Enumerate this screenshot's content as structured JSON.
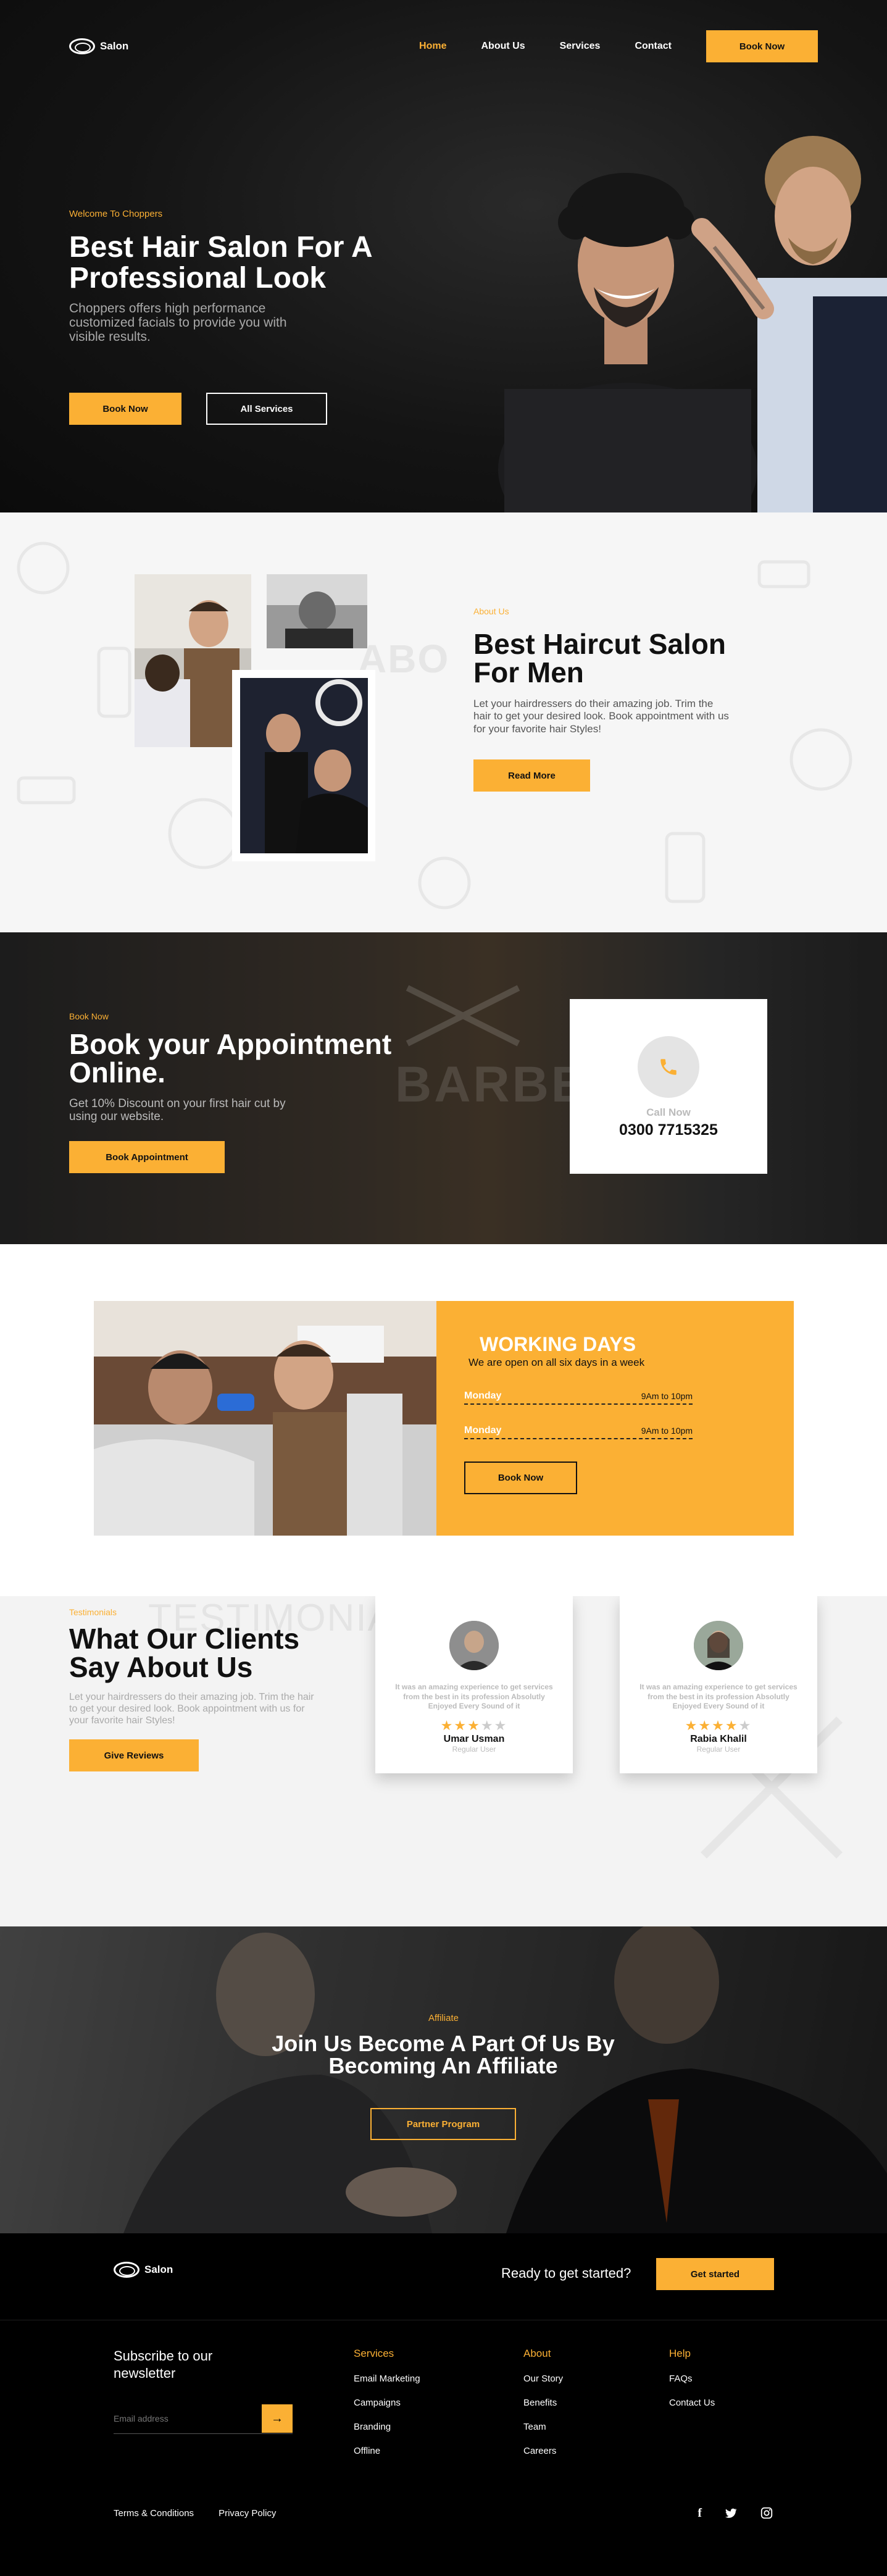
{
  "brand": {
    "name": "Salon",
    "accent": "#fbb034"
  },
  "nav": {
    "items": [
      "Home",
      "About Us",
      "Services",
      "Contact"
    ],
    "cta": "Book Now"
  },
  "hero": {
    "eyebrow": "Welcome To Choppers",
    "title": "Best Hair Salon For A Professional Look",
    "desc": "Choppers offers high performance customized facials to provide you with visible results.",
    "primary": "Book Now",
    "secondary": "All Services"
  },
  "about": {
    "eyebrow": "About Us",
    "bg_word": "ABO",
    "title": "Best Haircut Salon For Men",
    "desc": "Let your hairdressers do their amazing job. Trim the hair to get your desired look. Book appointment with us for your favorite hair Styles!",
    "button": "Read More"
  },
  "book": {
    "eyebrow": "Book Now",
    "title": "Book your Appointment Online.",
    "desc": "Get 10% Discount on your first hair cut by using our website.",
    "button": "Book Appointment",
    "call_label": "Call Now",
    "call_number": "0300 7715325"
  },
  "working": {
    "title": "WORKING DAYS",
    "subtitle": "We are open on all six days in a week",
    "rows": [
      {
        "day": "Monday",
        "hours": "9Am to 10pm"
      },
      {
        "day": "Monday",
        "hours": "9Am to 10pm"
      }
    ],
    "button": "Book Now"
  },
  "testimonials": {
    "eyebrow": "Testimonials",
    "bg_word": "TESTIMONIALS",
    "title": "What Our Clients Say About Us",
    "desc": "Let your hairdressers do their amazing job. Trim the hair to get your desired look. Book appointment with us for your favorite hair Styles!",
    "button": "Give Reviews",
    "cards": [
      {
        "quote": "It was an amazing experience to get services from the best in its profession Absolutly Enjoyed Every Sound of it",
        "rating": 3,
        "name": "Umar Usman",
        "role": "Regular User"
      },
      {
        "quote": "It was an amazing experience to get services from the best in its profession Absolutly Enjoyed Every Sound of it",
        "rating": 4,
        "name": "Rabia Khalil",
        "role": "Regular User"
      }
    ]
  },
  "affiliate": {
    "eyebrow": "Affiliate",
    "title": "Join Us Become A Part Of Us By Becoming An Affiliate",
    "button": "Partner Program"
  },
  "footer": {
    "ready": "Ready to get started?",
    "start": "Get started",
    "subscribe": "Subscribe to our newsletter",
    "email_placeholder": "Email address",
    "columns": [
      {
        "title": "Services",
        "items": [
          "Email Marketing",
          "Campaigns",
          "Branding",
          "Offline"
        ]
      },
      {
        "title": "About",
        "items": [
          "Our Story",
          "Benefits",
          "Team",
          "Careers"
        ]
      },
      {
        "title": "Help",
        "items": [
          "FAQs",
          "Contact Us"
        ]
      }
    ],
    "legal": [
      "Terms & Conditions",
      "Privacy Policy"
    ],
    "social_icons": [
      "facebook-icon",
      "twitter-icon",
      "instagram-icon"
    ]
  }
}
